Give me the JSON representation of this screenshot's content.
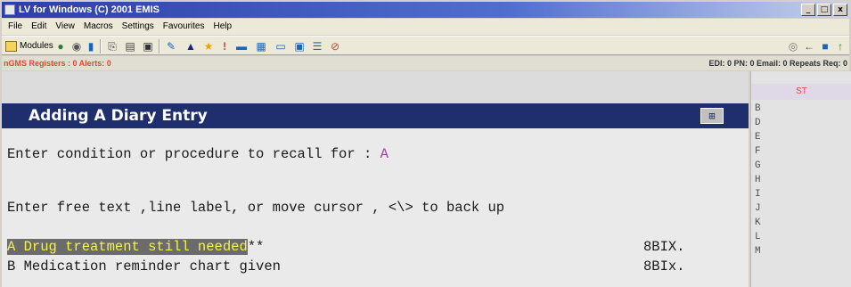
{
  "window": {
    "title": "LV for Windows (C) 2001 EMIS",
    "controls": [
      "_",
      "□",
      "x"
    ]
  },
  "menu": {
    "items": [
      "File",
      "Edit",
      "View",
      "Macros",
      "Settings",
      "Favourites",
      "Help"
    ]
  },
  "toolbar": {
    "modules_label": "Modules"
  },
  "status": {
    "left": "nGMS Registers : 0  Alerts: 0",
    "right": "EDI: 0  PN: 0  Email: 0  Repeats Req: 0"
  },
  "screen": {
    "header": "Adding A Diary Entry",
    "prompt_recall": "Enter condition or procedure to recall for : ",
    "prompt_recall_value": "A",
    "prompt_freetext": "Enter free text ,line label, or move cursor , <\\> to back up",
    "options": [
      {
        "label": "A Drug treatment still needed",
        "suffix": "**",
        "code": "8BIX."
      },
      {
        "label": "B Medication reminder chart given",
        "suffix": "",
        "code": "8BIx."
      }
    ]
  },
  "side_panel": {
    "header": "ST",
    "letters": [
      "B",
      "D",
      "E",
      "F",
      "G",
      "H",
      "I",
      "J",
      "K",
      "L",
      "M"
    ]
  }
}
